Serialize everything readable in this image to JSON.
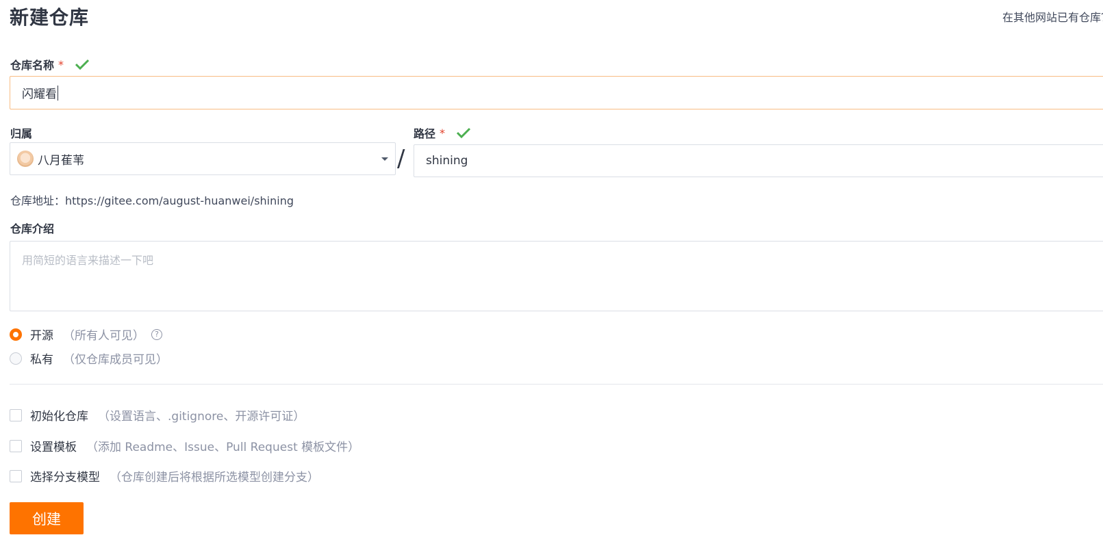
{
  "page": {
    "title": "新建仓库",
    "import_link": "在其他网站已有仓库？点击导入"
  },
  "repo_name": {
    "label": "仓库名称",
    "required_mark": "*",
    "value": "闪耀看"
  },
  "owner": {
    "label": "归属",
    "selected": "八月萑苇"
  },
  "path": {
    "label": "路径",
    "required_mark": "*",
    "value": "shining",
    "separator": "/"
  },
  "address": {
    "label": "仓库地址：",
    "url": "https://gitee.com/august-huanwei/shining"
  },
  "description": {
    "label": "仓库介绍",
    "placeholder": "用简短的语言来描述一下吧"
  },
  "visibility": {
    "options": [
      {
        "label": "开源",
        "hint": "（所有人可见）",
        "checked": true
      },
      {
        "label": "私有",
        "hint": "（仅仓库成员可见）",
        "checked": false
      }
    ],
    "help_symbol": "?"
  },
  "options": [
    {
      "label": "初始化仓库",
      "hint": "（设置语言、.gitignore、开源许可证）",
      "checked": false
    },
    {
      "label": "设置模板",
      "hint": "（添加 Readme、Issue、Pull Request 模板文件）",
      "checked": false
    },
    {
      "label": "选择分支模型",
      "hint": "（仓库创建后将根据所选模型创建分支）",
      "checked": false
    }
  ],
  "submit": {
    "label": "创建"
  },
  "colors": {
    "accent": "#fe7300",
    "valid_check": "#4caf50",
    "required": "#e2412b",
    "focus_border": "#f9bc83"
  }
}
